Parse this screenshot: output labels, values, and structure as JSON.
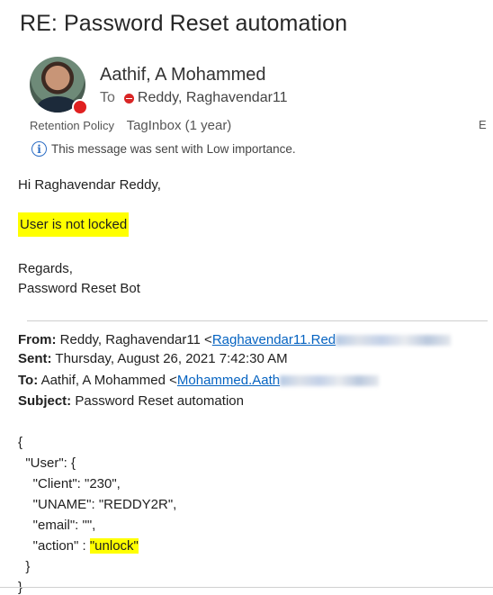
{
  "message": {
    "subject": "RE: Password Reset automation",
    "sender": "Aathif, A Mohammed",
    "to_label": "To",
    "recipient": "Reddy, Raghavendar11",
    "retention_label": "Retention Policy",
    "retention_value": "TagInbox (1 year)",
    "edge_text": "E",
    "importance_notice": "This message was sent with Low importance."
  },
  "body": {
    "greeting": "Hi Raghavendar Reddy,",
    "status": "User is not locked",
    "closing": "Regards,",
    "signature": "Password Reset Bot"
  },
  "quoted": {
    "from_label": "From:",
    "from_name": "Reddy, Raghavendar11 <",
    "from_email": "Raghavendar11.Red",
    "sent_label": "Sent:",
    "sent_value": "Thursday, August 26, 2021 7:42:30 AM",
    "to_label": "To:",
    "to_name": "Aathif, A Mohammed <",
    "to_email": "Mohammed.Aath",
    "subject_label": "Subject:",
    "subject_value": "Password Reset automation"
  },
  "json_lines": [
    "{",
    "  \"User\": {",
    "    \"Client\": \"230\",",
    "    \"UNAME\": \"REDDY2R\",",
    "    \"email\": \"\",",
    "    \"action\" : ",
    "  }",
    "}"
  ],
  "json_action_value": "\"unlock\"",
  "colors": {
    "highlight": "#ffff00",
    "link": "#0563c1",
    "presence_busy": "#e02020",
    "info_icon": "#2b6cc4"
  },
  "icons": {
    "info": "info-icon",
    "presence": "presence-busy-icon",
    "recipient_status": "blocked-status-icon"
  }
}
